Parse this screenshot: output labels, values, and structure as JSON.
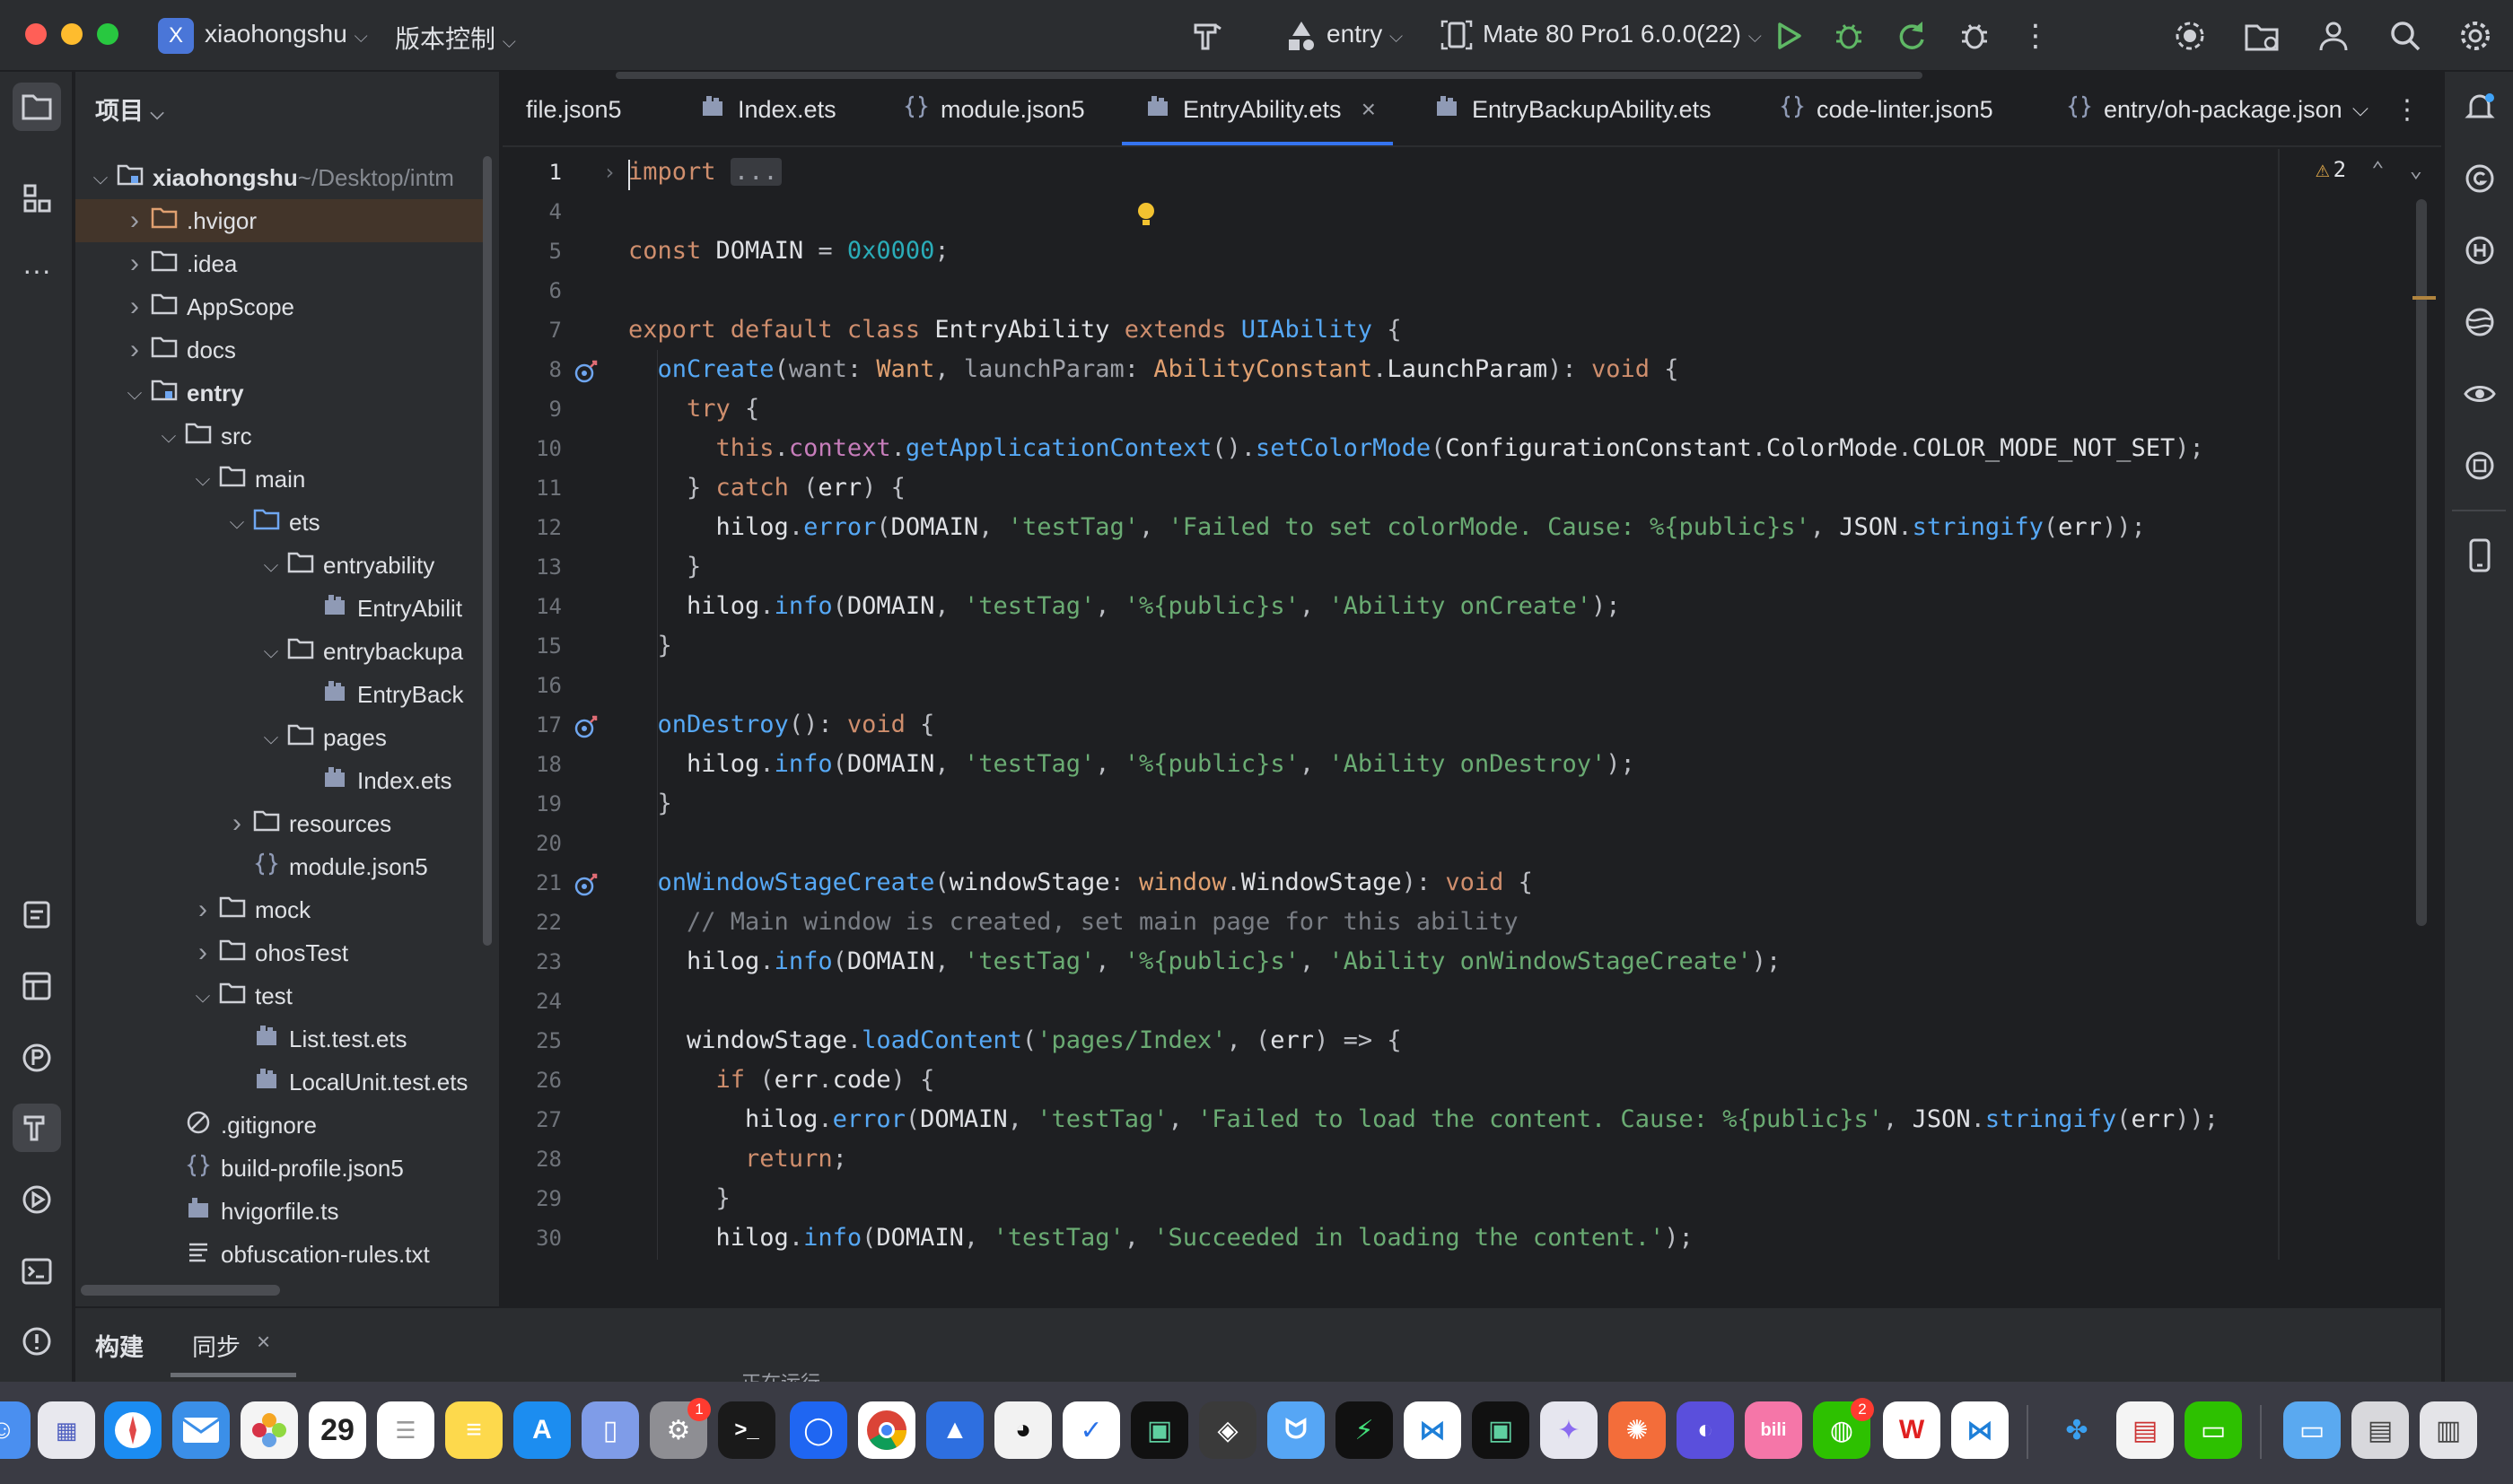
{
  "titlebar": {
    "project_badge": "X",
    "project_name": "xiaohongshu",
    "vcs_label": "版本控制",
    "module": "entry",
    "device": "Mate 80 Pro1 6.0.0(22)"
  },
  "project_panel": {
    "title": "项目",
    "tree": [
      {
        "label": "xiaohongshu",
        "suffix": " ~/Desktop/intm",
        "depth": 0,
        "chev": "open",
        "icon": "module-folder",
        "bold": true
      },
      {
        "label": ".hvigor",
        "depth": 1,
        "chev": "closed",
        "icon": "folder-orange",
        "selected": true
      },
      {
        "label": ".idea",
        "depth": 1,
        "chev": "closed",
        "icon": "folder"
      },
      {
        "label": "AppScope",
        "depth": 1,
        "chev": "closed",
        "icon": "folder"
      },
      {
        "label": "docs",
        "depth": 1,
        "chev": "closed",
        "icon": "folder"
      },
      {
        "label": "entry",
        "depth": 1,
        "chev": "open",
        "icon": "module-folder",
        "bold": true
      },
      {
        "label": "src",
        "depth": 2,
        "chev": "open",
        "icon": "folder"
      },
      {
        "label": "main",
        "depth": 3,
        "chev": "open",
        "icon": "folder"
      },
      {
        "label": "ets",
        "depth": 4,
        "chev": "open",
        "icon": "folder-blue"
      },
      {
        "label": "entryability",
        "depth": 5,
        "chev": "open",
        "icon": "folder"
      },
      {
        "label": "EntryAbilit",
        "depth": 6,
        "chev": "none",
        "icon": "ets-file"
      },
      {
        "label": "entrybackupa",
        "depth": 5,
        "chev": "open",
        "icon": "folder"
      },
      {
        "label": "EntryBack",
        "depth": 6,
        "chev": "none",
        "icon": "ets-file"
      },
      {
        "label": "pages",
        "depth": 5,
        "chev": "open",
        "icon": "folder"
      },
      {
        "label": "Index.ets",
        "depth": 6,
        "chev": "none",
        "icon": "ets-file"
      },
      {
        "label": "resources",
        "depth": 4,
        "chev": "closed",
        "icon": "folder"
      },
      {
        "label": "module.json5",
        "depth": 4,
        "chev": "none",
        "icon": "json-file"
      },
      {
        "label": "mock",
        "depth": 3,
        "chev": "closed",
        "icon": "folder"
      },
      {
        "label": "ohosTest",
        "depth": 3,
        "chev": "closed",
        "icon": "folder"
      },
      {
        "label": "test",
        "depth": 3,
        "chev": "open",
        "icon": "folder"
      },
      {
        "label": "List.test.ets",
        "depth": 4,
        "chev": "none",
        "icon": "ets-file"
      },
      {
        "label": "LocalUnit.test.ets",
        "depth": 4,
        "chev": "none",
        "icon": "ets-file"
      },
      {
        "label": ".gitignore",
        "depth": 2,
        "chev": "none",
        "icon": "ignore-file"
      },
      {
        "label": "build-profile.json5",
        "depth": 2,
        "chev": "none",
        "icon": "json-file"
      },
      {
        "label": "hvigorfile.ts",
        "depth": 2,
        "chev": "none",
        "icon": "ts-file"
      },
      {
        "label": "obfuscation-rules.txt",
        "depth": 2,
        "chev": "none",
        "icon": "text-file"
      }
    ]
  },
  "tabs": [
    {
      "label": "file.json5",
      "icon": "json"
    },
    {
      "label": "Index.ets",
      "icon": "ets"
    },
    {
      "label": "module.json5",
      "icon": "json"
    },
    {
      "label": "EntryAbility.ets",
      "icon": "ets",
      "active": true,
      "closable": true
    },
    {
      "label": "EntryBackupAbility.ets",
      "icon": "ets"
    },
    {
      "label": "code-linter.json5",
      "icon": "json"
    },
    {
      "label": "entry/oh-package.json",
      "icon": "json"
    }
  ],
  "editor": {
    "warning_count": "2",
    "lines": [
      {
        "n": "1",
        "tokens": [
          [
            "k",
            "import"
          ],
          [
            "w",
            " "
          ],
          [
            "pg",
            "..."
          ]
        ]
      },
      {
        "n": "4",
        "tokens": []
      },
      {
        "n": "5",
        "tokens": [
          [
            "k",
            "const "
          ],
          [
            "w",
            "DOMAIN"
          ],
          [
            "h",
            " = "
          ],
          [
            "n",
            "0x0000"
          ],
          [
            "h",
            ";"
          ]
        ]
      },
      {
        "n": "6",
        "tokens": []
      },
      {
        "n": "7",
        "tokens": [
          [
            "k",
            "export default class "
          ],
          [
            "w",
            "EntryAbility "
          ],
          [
            "k",
            "extends "
          ],
          [
            "f",
            "UIAbility "
          ],
          [
            "h",
            "{"
          ]
        ]
      },
      {
        "n": "8",
        "tokens": [
          [
            "f",
            "  onCreate"
          ],
          [
            "h",
            "("
          ],
          [
            "pg",
            "want"
          ],
          [
            "h",
            ": "
          ],
          [
            "t",
            "Want"
          ],
          [
            "h",
            ", "
          ],
          [
            "pg",
            "launchParam"
          ],
          [
            "h",
            ": "
          ],
          [
            "t",
            "AbilityConstant"
          ],
          [
            "h",
            "."
          ],
          [
            "w",
            "LaunchParam"
          ],
          [
            "h",
            "): "
          ],
          [
            "k",
            "void "
          ],
          [
            "h",
            "{"
          ]
        ]
      },
      {
        "n": "9",
        "tokens": [
          [
            "k",
            "    try "
          ],
          [
            "h",
            "{"
          ]
        ]
      },
      {
        "n": "10",
        "tokens": [
          [
            "k",
            "      this"
          ],
          [
            "h",
            "."
          ],
          [
            "p",
            "context"
          ],
          [
            "h",
            "."
          ],
          [
            "f",
            "getApplicationContext"
          ],
          [
            "h",
            "()."
          ],
          [
            "f",
            "setColorMode"
          ],
          [
            "h",
            "("
          ],
          [
            "w",
            "ConfigurationConstant"
          ],
          [
            "h",
            "."
          ],
          [
            "w",
            "ColorMode"
          ],
          [
            "h",
            "."
          ],
          [
            "w",
            "COLOR_MODE_NOT_SET"
          ],
          [
            "h",
            ");"
          ]
        ]
      },
      {
        "n": "11",
        "tokens": [
          [
            "h",
            "    } "
          ],
          [
            "k",
            "catch "
          ],
          [
            "h",
            "("
          ],
          [
            "w",
            "err"
          ],
          [
            "h",
            ") {"
          ]
        ]
      },
      {
        "n": "12",
        "tokens": [
          [
            "w",
            "      hilog"
          ],
          [
            "h",
            "."
          ],
          [
            "f",
            "error"
          ],
          [
            "h",
            "("
          ],
          [
            "w",
            "DOMAIN"
          ],
          [
            "h",
            ", "
          ],
          [
            "s",
            "'testTag'"
          ],
          [
            "h",
            ", "
          ],
          [
            "s",
            "'Failed to set colorMode. Cause: %{public}s'"
          ],
          [
            "h",
            ", "
          ],
          [
            "w",
            "JSON"
          ],
          [
            "h",
            "."
          ],
          [
            "f",
            "stringify"
          ],
          [
            "h",
            "("
          ],
          [
            "w",
            "err"
          ],
          [
            "h",
            "));"
          ]
        ]
      },
      {
        "n": "13",
        "tokens": [
          [
            "h",
            "    }"
          ]
        ]
      },
      {
        "n": "14",
        "tokens": [
          [
            "w",
            "    hilog"
          ],
          [
            "h",
            "."
          ],
          [
            "f",
            "info"
          ],
          [
            "h",
            "("
          ],
          [
            "w",
            "DOMAIN"
          ],
          [
            "h",
            ", "
          ],
          [
            "s",
            "'testTag'"
          ],
          [
            "h",
            ", "
          ],
          [
            "s",
            "'%{public}s'"
          ],
          [
            "h",
            ", "
          ],
          [
            "s",
            "'Ability onCreate'"
          ],
          [
            "h",
            ");"
          ]
        ]
      },
      {
        "n": "15",
        "tokens": [
          [
            "h",
            "  }"
          ]
        ]
      },
      {
        "n": "16",
        "tokens": []
      },
      {
        "n": "17",
        "tokens": [
          [
            "f",
            "  onDestroy"
          ],
          [
            "h",
            "(): "
          ],
          [
            "k",
            "void "
          ],
          [
            "h",
            "{"
          ]
        ]
      },
      {
        "n": "18",
        "tokens": [
          [
            "w",
            "    hilog"
          ],
          [
            "h",
            "."
          ],
          [
            "f",
            "info"
          ],
          [
            "h",
            "("
          ],
          [
            "w",
            "DOMAIN"
          ],
          [
            "h",
            ", "
          ],
          [
            "s",
            "'testTag'"
          ],
          [
            "h",
            ", "
          ],
          [
            "s",
            "'%{public}s'"
          ],
          [
            "h",
            ", "
          ],
          [
            "s",
            "'Ability onDestroy'"
          ],
          [
            "h",
            ");"
          ]
        ]
      },
      {
        "n": "19",
        "tokens": [
          [
            "h",
            "  }"
          ]
        ]
      },
      {
        "n": "20",
        "tokens": []
      },
      {
        "n": "21",
        "tokens": [
          [
            "f",
            "  onWindowStageCreate"
          ],
          [
            "h",
            "("
          ],
          [
            "w",
            "windowStage"
          ],
          [
            "h",
            ": "
          ],
          [
            "t",
            "window"
          ],
          [
            "h",
            "."
          ],
          [
            "w",
            "WindowStage"
          ],
          [
            "h",
            "): "
          ],
          [
            "k",
            "void "
          ],
          [
            "h",
            "{"
          ]
        ]
      },
      {
        "n": "22",
        "tokens": [
          [
            "c",
            "    // Main window is created, set main page for this ability"
          ]
        ]
      },
      {
        "n": "23",
        "tokens": [
          [
            "w",
            "    hilog"
          ],
          [
            "h",
            "."
          ],
          [
            "f",
            "info"
          ],
          [
            "h",
            "("
          ],
          [
            "w",
            "DOMAIN"
          ],
          [
            "h",
            ", "
          ],
          [
            "s",
            "'testTag'"
          ],
          [
            "h",
            ", "
          ],
          [
            "s",
            "'%{public}s'"
          ],
          [
            "h",
            ", "
          ],
          [
            "s",
            "'Ability onWindowStageCreate'"
          ],
          [
            "h",
            ");"
          ]
        ]
      },
      {
        "n": "24",
        "tokens": []
      },
      {
        "n": "25",
        "tokens": [
          [
            "w",
            "    windowStage"
          ],
          [
            "h",
            "."
          ],
          [
            "f",
            "loadContent"
          ],
          [
            "h",
            "("
          ],
          [
            "s",
            "'pages/Index'"
          ],
          [
            "h",
            ", ("
          ],
          [
            "w",
            "err"
          ],
          [
            "h",
            ") => {"
          ]
        ]
      },
      {
        "n": "26",
        "tokens": [
          [
            "k",
            "      if "
          ],
          [
            "h",
            "("
          ],
          [
            "w",
            "err"
          ],
          [
            "h",
            "."
          ],
          [
            "w",
            "code"
          ],
          [
            "h",
            ") {"
          ]
        ]
      },
      {
        "n": "27",
        "tokens": [
          [
            "w",
            "        hilog"
          ],
          [
            "h",
            "."
          ],
          [
            "f",
            "error"
          ],
          [
            "h",
            "("
          ],
          [
            "w",
            "DOMAIN"
          ],
          [
            "h",
            ", "
          ],
          [
            "s",
            "'testTag'"
          ],
          [
            "h",
            ", "
          ],
          [
            "s",
            "'Failed to load the content. Cause: %{public}s'"
          ],
          [
            "h",
            ", "
          ],
          [
            "w",
            "JSON"
          ],
          [
            "h",
            "."
          ],
          [
            "f",
            "stringify"
          ],
          [
            "h",
            "("
          ],
          [
            "w",
            "err"
          ],
          [
            "h",
            "));"
          ]
        ]
      },
      {
        "n": "28",
        "tokens": [
          [
            "k",
            "        return"
          ],
          [
            "h",
            ";"
          ]
        ]
      },
      {
        "n": "29",
        "tokens": [
          [
            "h",
            "      }"
          ]
        ]
      },
      {
        "n": "30",
        "tokens": [
          [
            "w",
            "      hilog"
          ],
          [
            "h",
            "."
          ],
          [
            "f",
            "info"
          ],
          [
            "h",
            "("
          ],
          [
            "w",
            "DOMAIN"
          ],
          [
            "h",
            ", "
          ],
          [
            "s",
            "'testTag'"
          ],
          [
            "h",
            ", "
          ],
          [
            "s",
            "'Succeeded in loading the content.'"
          ],
          [
            "h",
            ");"
          ]
        ]
      }
    ]
  },
  "bottom": {
    "tab_build": "构建",
    "tab_sync": "同步",
    "status_partial": "正在运行…"
  },
  "dock": {
    "calendar_day": "29",
    "settings_badge": "1",
    "wechat_badge": "2"
  }
}
